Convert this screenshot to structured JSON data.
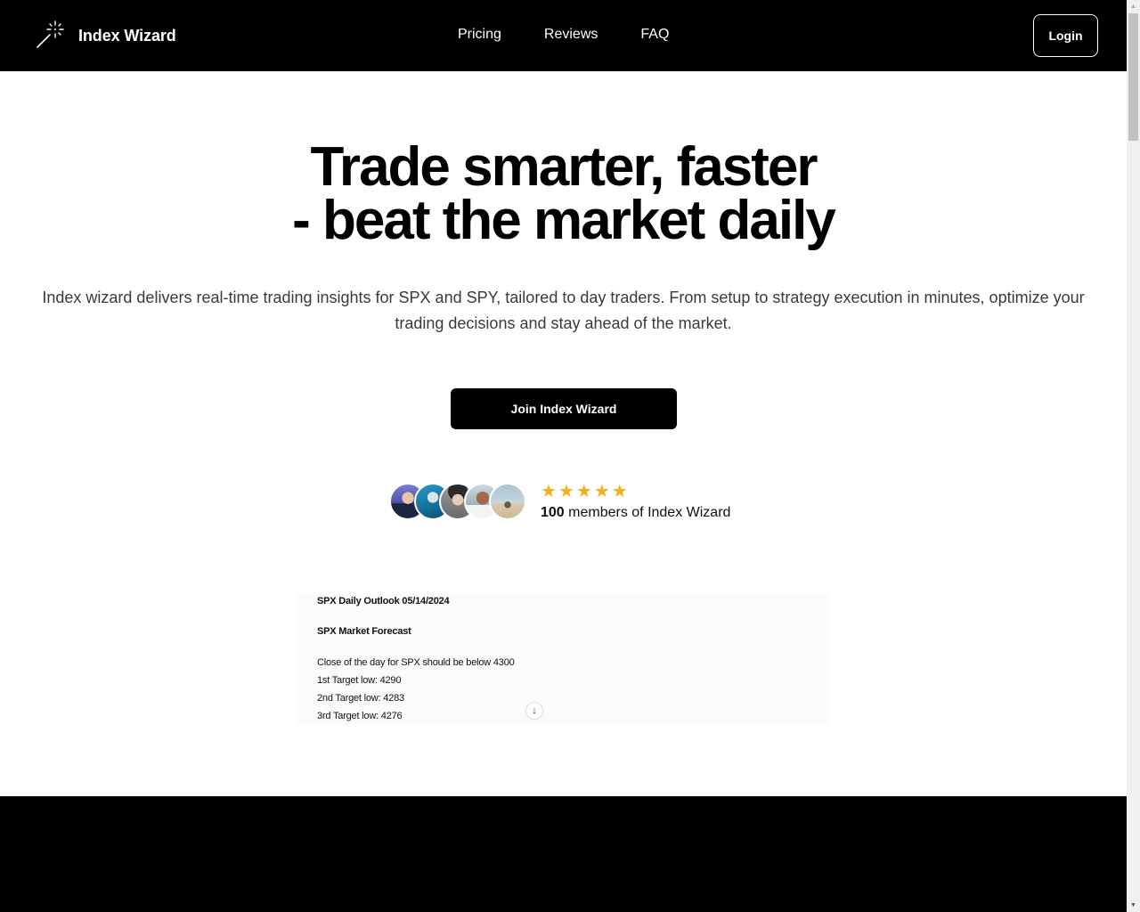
{
  "header": {
    "brand_name": "Index Wizard",
    "logo_icon": "magic-wand-icon",
    "nav": [
      {
        "label": "Pricing"
      },
      {
        "label": "Reviews"
      },
      {
        "label": "FAQ"
      }
    ],
    "login_label": "Login"
  },
  "hero": {
    "headline_line1": "Trade smarter, faster",
    "headline_line2": "- beat the market daily",
    "subtext": "Index wizard delivers real-time trading insights for SPX and SPY, tailored to day traders. From setup to strategy execution in minutes, optimize your trading decisions and stay ahead of the market.",
    "cta_label": "Join Index Wizard"
  },
  "social_proof": {
    "rating_stars": 5,
    "rating_max": 5,
    "star_color": "#f2b01e",
    "member_count": "100",
    "member_suffix": " members of Index Wizard",
    "avatar_count": 5
  },
  "preview": {
    "title": "SPX Daily Outlook 05/14/2024",
    "section": "SPX Market Forecast",
    "lines": [
      "Close of the day for SPX should be below 4300",
      "1st Target low: 4290",
      "2nd Target low: 4283",
      "3rd Target low: 4276"
    ],
    "scroll_icon": "arrow-down-icon"
  },
  "colors": {
    "header_bg": "#000000",
    "accent": "#000000",
    "star": "#f2b01e"
  }
}
